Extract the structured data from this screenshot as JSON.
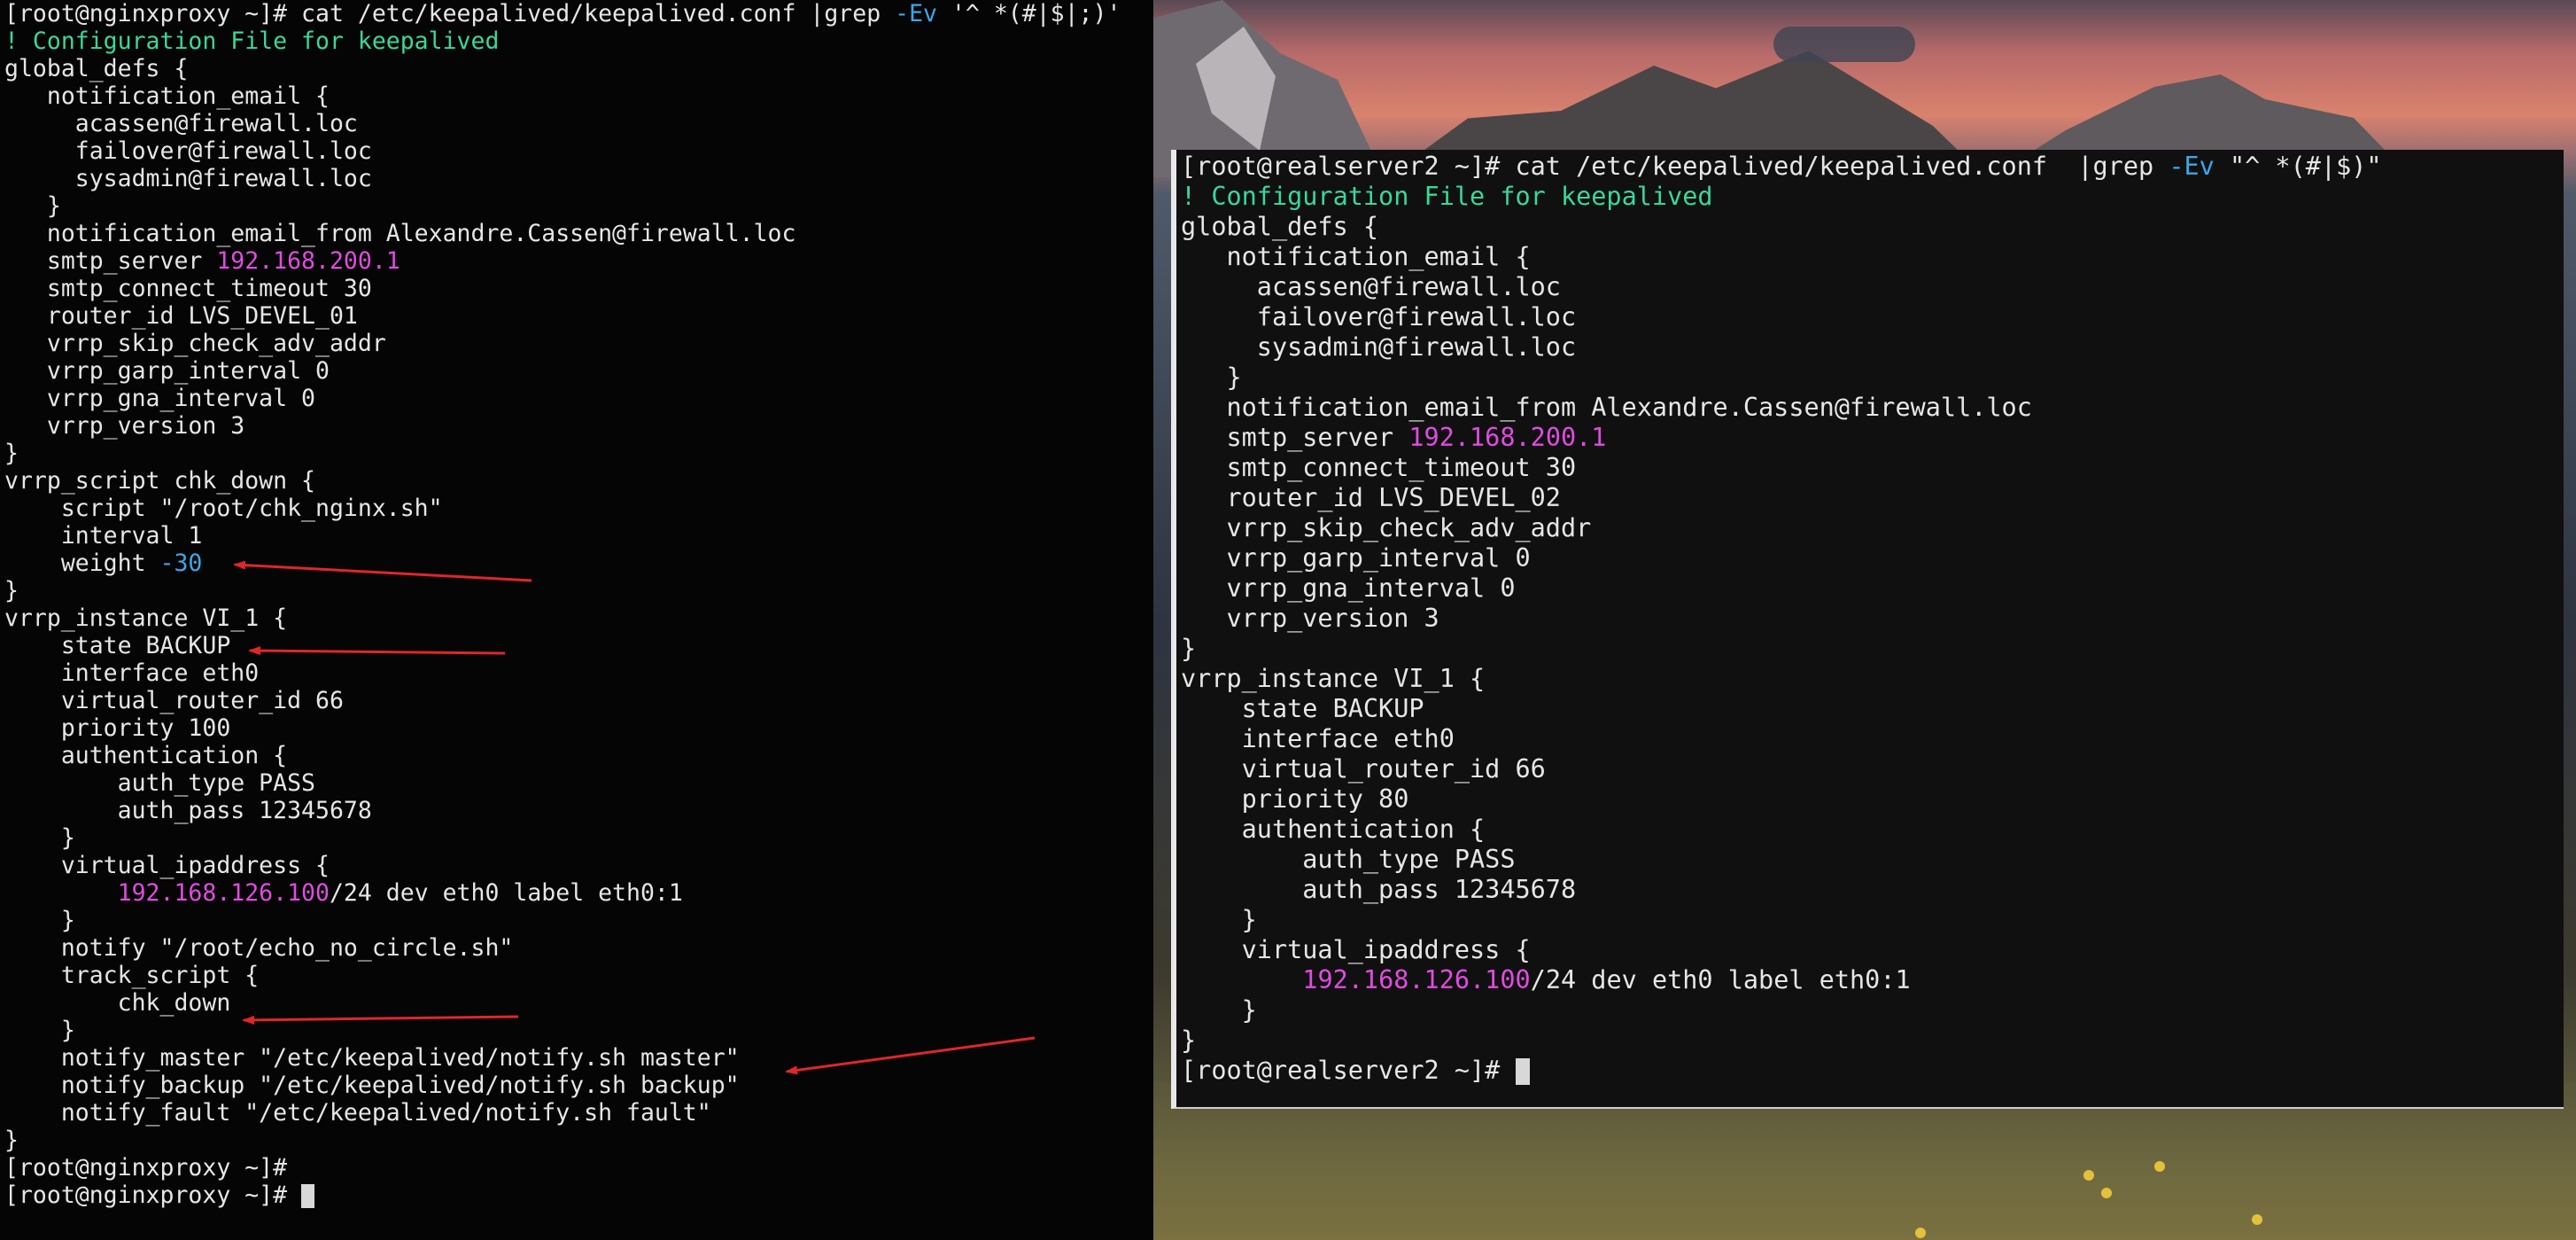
{
  "left_terminal": {
    "lines": [
      [
        {
          "t": "[root@nginxproxy ~]# cat /etc/keepalived/keepalived.conf |grep "
        },
        {
          "t": "-Ev",
          "c": "blue"
        },
        {
          "t": " '^ *(#|$|;)'"
        }
      ],
      [
        {
          "t": "! Configuration File for keepalived",
          "c": "green"
        }
      ],
      [
        {
          "t": "global_defs {"
        }
      ],
      [
        {
          "t": "   notification_email {"
        }
      ],
      [
        {
          "t": "     acassen@firewall.loc"
        }
      ],
      [
        {
          "t": "     failover@firewall.loc"
        }
      ],
      [
        {
          "t": "     sysadmin@firewall.loc"
        }
      ],
      [
        {
          "t": "   }"
        }
      ],
      [
        {
          "t": "   notification_email_from Alexandre.Cassen@firewall.loc"
        }
      ],
      [
        {
          "t": "   smtp_server "
        },
        {
          "t": "192.168.200.1",
          "c": "magenta"
        }
      ],
      [
        {
          "t": "   smtp_connect_timeout 30"
        }
      ],
      [
        {
          "t": "   router_id LVS_DEVEL_01"
        }
      ],
      [
        {
          "t": "   vrrp_skip_check_adv_addr"
        }
      ],
      [
        {
          "t": "   vrrp_garp_interval 0"
        }
      ],
      [
        {
          "t": "   vrrp_gna_interval 0"
        }
      ],
      [
        {
          "t": "   vrrp_version 3"
        }
      ],
      [
        {
          "t": "}"
        }
      ],
      [
        {
          "t": "vrrp_script chk_down {"
        }
      ],
      [
        {
          "t": "    script \"/root/chk_nginx.sh\""
        }
      ],
      [
        {
          "t": "    interval 1"
        }
      ],
      [
        {
          "t": "    weight "
        },
        {
          "t": "-30",
          "c": "blue"
        }
      ],
      [
        {
          "t": "}"
        }
      ],
      [
        {
          "t": "vrrp_instance VI_1 {"
        }
      ],
      [
        {
          "t": "    state BACKUP"
        }
      ],
      [
        {
          "t": "    interface eth0"
        }
      ],
      [
        {
          "t": "    virtual_router_id 66"
        }
      ],
      [
        {
          "t": "    priority 100"
        }
      ],
      [
        {
          "t": "    authentication {"
        }
      ],
      [
        {
          "t": "        auth_type PASS"
        }
      ],
      [
        {
          "t": "        auth_pass 12345678"
        }
      ],
      [
        {
          "t": "    }"
        }
      ],
      [
        {
          "t": "    virtual_ipaddress {"
        }
      ],
      [
        {
          "t": "        "
        },
        {
          "t": "192.168.126.100",
          "c": "magenta"
        },
        {
          "t": "/24 dev eth0 label eth0:1"
        }
      ],
      [
        {
          "t": "    }"
        }
      ],
      [
        {
          "t": "    notify \"/root/echo_no_circle.sh\""
        }
      ],
      [
        {
          "t": "    track_script {"
        }
      ],
      [
        {
          "t": "        chk_down"
        }
      ],
      [
        {
          "t": "    }"
        }
      ],
      [
        {
          "t": "    notify_master \"/etc/keepalived/notify.sh master\""
        }
      ],
      [
        {
          "t": "    notify_backup \"/etc/keepalived/notify.sh backup\""
        }
      ],
      [
        {
          "t": "    notify_fault \"/etc/keepalived/notify.sh fault\""
        }
      ],
      [
        {
          "t": "}"
        }
      ],
      [
        {
          "t": "[root@nginxproxy ~]#"
        }
      ],
      [
        {
          "t": "[root@nginxproxy ~]# "
        },
        {
          "cursor": true
        }
      ]
    ]
  },
  "right_terminal": {
    "lines": [
      [
        {
          "t": "[root@realserver2 ~]# cat /etc/keepalived/keepalived.conf  |grep "
        },
        {
          "t": "-Ev",
          "c": "blue"
        },
        {
          "t": " \"^ *(#|$)\""
        }
      ],
      [
        {
          "t": "! Configuration File for keepalived",
          "c": "green"
        }
      ],
      [
        {
          "t": "global_defs {"
        }
      ],
      [
        {
          "t": "   notification_email {"
        }
      ],
      [
        {
          "t": "     acassen@firewall.loc"
        }
      ],
      [
        {
          "t": "     failover@firewall.loc"
        }
      ],
      [
        {
          "t": "     sysadmin@firewall.loc"
        }
      ],
      [
        {
          "t": "   }"
        }
      ],
      [
        {
          "t": "   notification_email_from Alexandre.Cassen@firewall.loc"
        }
      ],
      [
        {
          "t": "   smtp_server "
        },
        {
          "t": "192.168.200.1",
          "c": "magenta"
        }
      ],
      [
        {
          "t": "   smtp_connect_timeout 30"
        }
      ],
      [
        {
          "t": "   router_id LVS_DEVEL_02"
        }
      ],
      [
        {
          "t": "   vrrp_skip_check_adv_addr"
        }
      ],
      [
        {
          "t": "   vrrp_garp_interval 0"
        }
      ],
      [
        {
          "t": "   vrrp_gna_interval 0"
        }
      ],
      [
        {
          "t": "   vrrp_version 3"
        }
      ],
      [
        {
          "t": "}"
        }
      ],
      [
        {
          "t": "vrrp_instance VI_1 {"
        }
      ],
      [
        {
          "t": "    state BACKUP"
        }
      ],
      [
        {
          "t": "    interface eth0"
        }
      ],
      [
        {
          "t": "    virtual_router_id 66"
        }
      ],
      [
        {
          "t": "    priority 80"
        }
      ],
      [
        {
          "t": "    authentication {"
        }
      ],
      [
        {
          "t": "        auth_type PASS"
        }
      ],
      [
        {
          "t": "        auth_pass 12345678"
        }
      ],
      [
        {
          "t": "    }"
        }
      ],
      [
        {
          "t": "    virtual_ipaddress {"
        }
      ],
      [
        {
          "t": "        "
        },
        {
          "t": "192.168.126.100",
          "c": "magenta"
        },
        {
          "t": "/24 dev eth0 label eth0:1"
        }
      ],
      [
        {
          "t": "    }"
        }
      ],
      [
        {
          "t": "}"
        }
      ],
      [
        {
          "t": "[root@realserver2 ~]# "
        },
        {
          "cursor": true
        }
      ]
    ]
  },
  "colors": {
    "green": "#38d89a",
    "blue": "#3aa7e8",
    "magenta": "#e04be0",
    "annotation_arrow": "#e0262a"
  },
  "annotations": [
    {
      "icon": "red-arrow-icon",
      "points_to": "weight -30"
    },
    {
      "icon": "red-arrow-icon",
      "points_to": "state BACKUP"
    },
    {
      "icon": "red-arrow-icon",
      "points_to": "chk_down"
    },
    {
      "icon": "red-arrow-icon",
      "points_to": "notify_master"
    }
  ]
}
